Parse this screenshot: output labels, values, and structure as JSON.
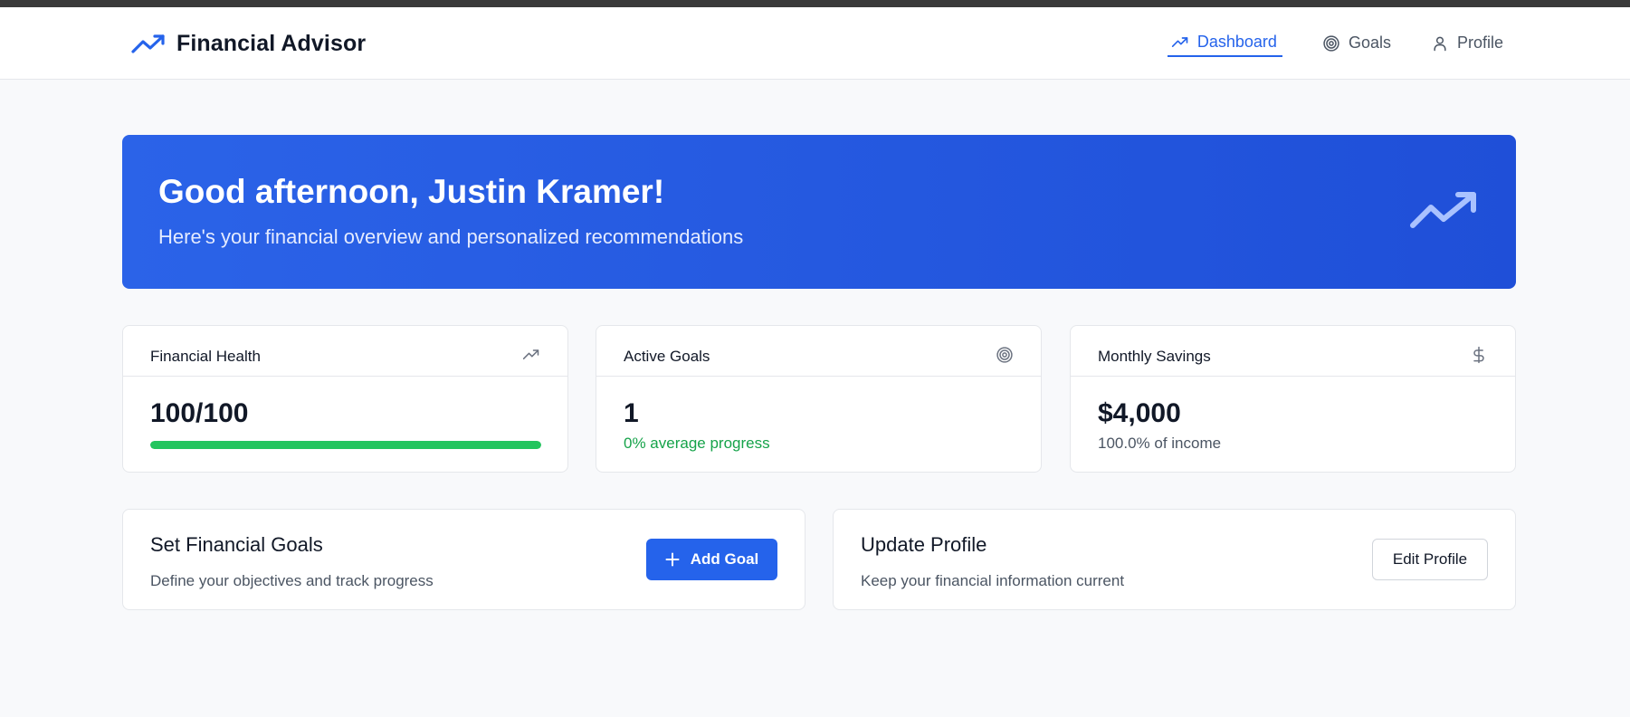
{
  "app": {
    "title": "Financial Advisor",
    "brand_icon": "trending-up-icon",
    "accent_color": "#2563eb"
  },
  "nav": {
    "items": [
      {
        "label": "Dashboard",
        "icon": "trending-up-icon",
        "active": true
      },
      {
        "label": "Goals",
        "icon": "target-icon",
        "active": false
      },
      {
        "label": "Profile",
        "icon": "user-icon",
        "active": false
      }
    ]
  },
  "hero": {
    "greeting": "Good afternoon, Justin Kramer!",
    "subtitle": "Here's your financial overview and personalized recommendations",
    "icon": "trending-up-icon"
  },
  "stats": {
    "health": {
      "label": "Financial Health",
      "value": "100/100",
      "icon": "trending-up-icon",
      "progress": 1.0,
      "progress_color": "#22c55e"
    },
    "goals": {
      "label": "Active Goals",
      "value": "1",
      "note": "0% average progress",
      "note_color": "#16a34a",
      "icon": "target-icon"
    },
    "savings": {
      "label": "Monthly Savings",
      "value": "$4,000",
      "note": "100.0% of income",
      "icon": "dollar-icon"
    }
  },
  "actions": {
    "goals": {
      "title": "Set Financial Goals",
      "description": "Define your objectives and track progress",
      "button_label": "Add Goal",
      "button_icon": "plus-icon"
    },
    "profile": {
      "title": "Update Profile",
      "description": "Keep your financial information current",
      "button_label": "Edit Profile"
    }
  }
}
